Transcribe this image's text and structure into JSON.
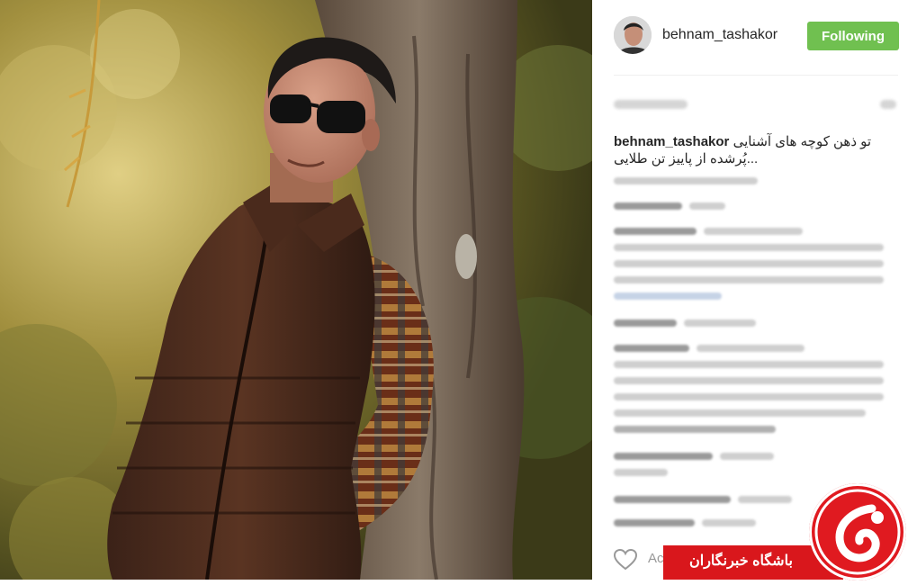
{
  "post": {
    "username": "behnam_tashakor",
    "follow_label": "Following",
    "caption_user": "behnam_tashakor",
    "caption_line1": "تو ذهن کوچه های آشنایی",
    "caption_line2": "پُرشده از پاییز تن طلایی..."
  },
  "comment_box": {
    "placeholder": "Ac"
  },
  "watermark": {
    "text": "باشگاه خبرنگاران"
  },
  "icons": {
    "heart": "heart-icon",
    "logo": "watermark-logo-icon"
  },
  "colors": {
    "follow_button": "#70c050",
    "watermark_red": "#d9171c",
    "text": "#262626"
  }
}
